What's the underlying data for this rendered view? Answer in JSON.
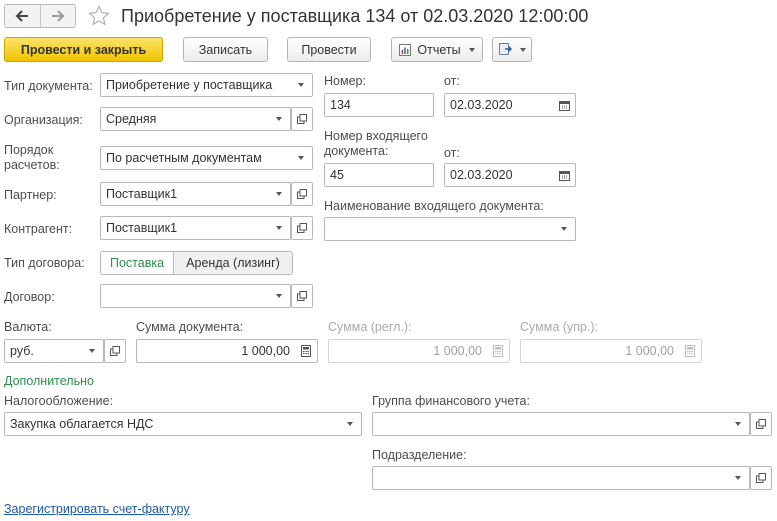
{
  "window": {
    "title": "Приобретение у поставщика 134 от 02.03.2020 12:00:00",
    "back_icon": "arrow-left-icon",
    "forward_icon": "arrow-right-icon",
    "favorite_icon": "star-icon"
  },
  "toolbar": {
    "post_close_label": "Провести и закрыть",
    "save_label": "Записать",
    "post_label": "Провести",
    "reports_label": "Отчеты",
    "more_icon": "documents-menu-icon"
  },
  "form": {
    "doc_type": {
      "label": "Тип документа:",
      "value": "Приобретение у поставщика"
    },
    "organization": {
      "label": "Организация:",
      "value": "Средняя"
    },
    "settlement": {
      "label": "Порядок расчетов:",
      "value": "По расчетным документам"
    },
    "partner": {
      "label": "Партнер:",
      "value": "Поставщик1"
    },
    "counterparty": {
      "label": "Контрагент:",
      "value": "Поставщик1"
    },
    "contract_type": {
      "label": "Тип договора:",
      "options": [
        "Поставка",
        "Аренда (лизинг)"
      ],
      "selected": "Поставка"
    },
    "contract": {
      "label": "Договор:",
      "value": ""
    },
    "number": {
      "label": "Номер:",
      "value": "134"
    },
    "date": {
      "label": "от:",
      "value": "02.03.2020"
    },
    "incoming_number": {
      "label": "Номер входящего документа:",
      "value": "45"
    },
    "incoming_date": {
      "label": "от:",
      "value": "02.03.2020"
    },
    "incoming_name": {
      "label": "Наименование входящего документа:",
      "value": ""
    },
    "currency": {
      "label": "Валюта:",
      "value": "руб."
    },
    "doc_sum": {
      "label": "Сумма документа:",
      "value": "1 000,00"
    },
    "sum_regl": {
      "label": "Сумма (регл.):",
      "value": "1 000,00"
    },
    "sum_upr": {
      "label": "Сумма (упр.):",
      "value": "1 000,00"
    }
  },
  "additional": {
    "section_title": "Дополнительно",
    "taxation": {
      "label": "Налогообложение:",
      "value": "Закупка облагается НДС"
    },
    "fin_group": {
      "label": "Группа финансового учета:",
      "value": ""
    },
    "department": {
      "label": "Подразделение:",
      "value": ""
    }
  },
  "register_invoice_link": "Зарегистрировать счет-фактуру",
  "colors": {
    "accent_green": "#2b8f4a",
    "link_blue": "#1c5aa6",
    "primary_yellow": "#f1c400"
  }
}
